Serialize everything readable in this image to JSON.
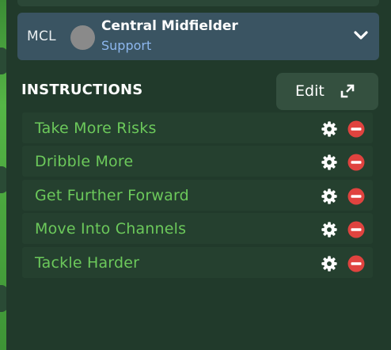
{
  "role": {
    "code": "MCL",
    "position": "Central Midfielder",
    "duty": "Support",
    "expand_icon": "chevron-down-icon"
  },
  "instructions": {
    "title": "INSTRUCTIONS",
    "edit_label": "Edit",
    "edit_icon": "expand-icon",
    "items": [
      {
        "label": "Take More Risks"
      },
      {
        "label": "Dribble More"
      },
      {
        "label": "Get Further Forward"
      },
      {
        "label": "Move Into Channels"
      },
      {
        "label": "Tackle Harder"
      }
    ]
  },
  "colors": {
    "background": "#213a2b",
    "role_card": "#3a5462",
    "duty_text": "#8db7ee",
    "instruction_text": "#6cc95b",
    "remove_icon": "#e0433f",
    "accent_edge": "#47a13c"
  }
}
